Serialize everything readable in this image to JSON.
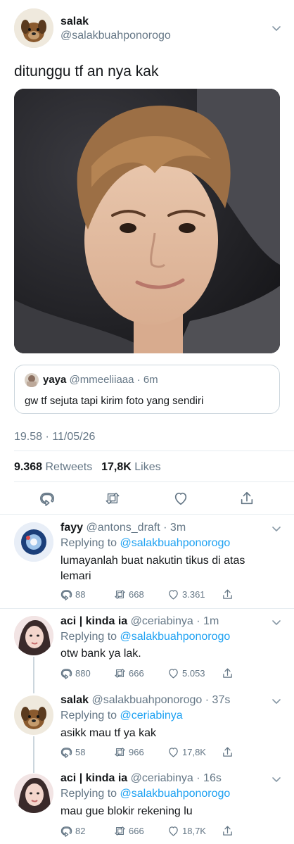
{
  "main_tweet": {
    "name": "salak",
    "handle": "@salakbuahponorogo",
    "text": "ditunggu tf an nya kak",
    "timestamp": "19.58 · 11/05/26",
    "retweets_count": "9.368",
    "retweets_label": "Retweets",
    "likes_count": "17,8K",
    "likes_label": "Likes"
  },
  "quoted_tweet": {
    "name": "yaya",
    "handle": "@mmeeliiaaa",
    "time": "· 6m",
    "text": "gw tf sejuta tapi kirim foto yang sendiri"
  },
  "replies": [
    {
      "name": "fayy",
      "handle": "@antons_draft",
      "time": "· 3m",
      "replying_prefix": "Replying to",
      "replying_to": "@salakbuahponorogo",
      "text_line1": "lumayanlah buat nakutin tikus di atas",
      "text_line2": "lemari",
      "replies": "88",
      "retweets": "668",
      "likes": "3.361"
    },
    {
      "name": "aci | kinda ia",
      "handle": "@ceriabinya",
      "time": "· 1m",
      "replying_prefix": "Replying to",
      "replying_to": "@salakbuahponorogo",
      "text": "otw bank ya lak.",
      "replies": "880",
      "retweets": "666",
      "likes": "5.053"
    },
    {
      "name": "salak",
      "handle": "@salakbuahponorogo",
      "time": "· 37s",
      "replying_prefix": "Replying to",
      "replying_to": "@ceriabinya",
      "text": "asikk mau tf ya kak",
      "replies": "58",
      "retweets": "966",
      "likes": "17,8K"
    },
    {
      "name": "aci | kinda ia",
      "handle": "@ceriabinya",
      "time": "· 16s",
      "replying_prefix": "Replying to",
      "replying_to": "@salakbuahponorogo",
      "text": "mau gue blokir rekening lu",
      "replies": "82",
      "retweets": "666",
      "likes": "18,7K"
    }
  ],
  "colors": {
    "accent": "#1da1f2",
    "muted": "#657786",
    "divider": "#e6ecf0"
  },
  "icons": [
    "chevron-down-icon",
    "reply-icon",
    "retweet-icon",
    "like-icon",
    "share-icon"
  ]
}
